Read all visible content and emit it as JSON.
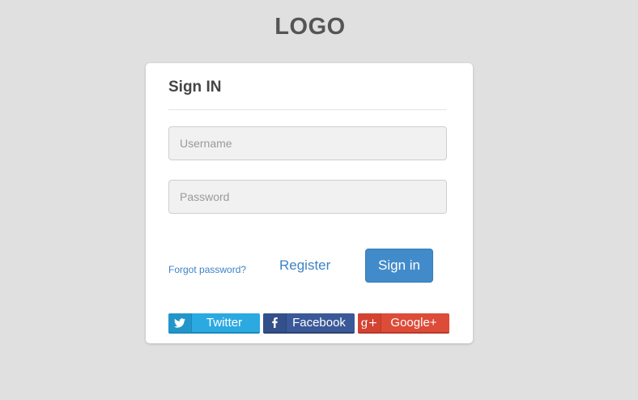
{
  "logo": {
    "text": "LOGO"
  },
  "form": {
    "title": "Sign IN",
    "username": {
      "placeholder": "Username",
      "value": ""
    },
    "password": {
      "placeholder": "Password",
      "value": ""
    },
    "forgot_label": "Forgot password?",
    "register_label": "Register",
    "signin_label": "Sign in"
  },
  "social": {
    "twitter": {
      "label": "Twitter",
      "icon": "twitter-bird-icon",
      "color": "#2ba9e1"
    },
    "facebook": {
      "label": "Facebook",
      "icon": "facebook-f-icon",
      "color": "#3b5998"
    },
    "google": {
      "label": "Google+",
      "icon": "google-plus-icon",
      "icon_text": "g+",
      "color": "#dd4b39"
    }
  },
  "colors": {
    "background": "#e0e0e0",
    "accent": "#428bca",
    "link": "#3e83c6"
  }
}
